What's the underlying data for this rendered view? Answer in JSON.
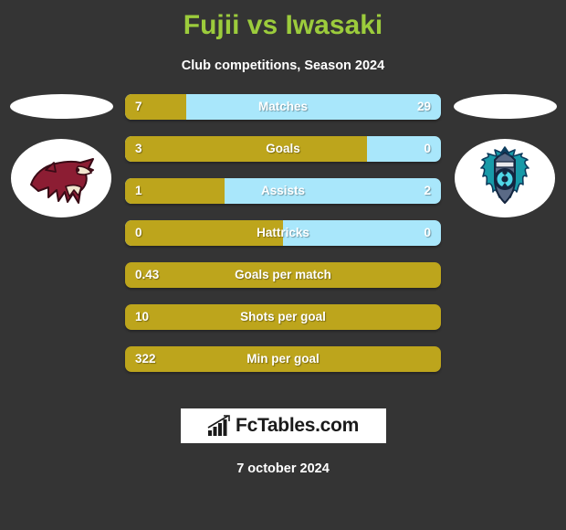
{
  "header": {
    "title": "Fujii vs Iwasaki",
    "subtitle": "Club competitions, Season 2024",
    "title_color": "#9ccc3c"
  },
  "teams": {
    "left": {
      "crest": "coyote-head-crest",
      "name": ""
    },
    "right": {
      "crest": "ornate-shield-crest",
      "name": ""
    }
  },
  "colors": {
    "background": "#343434",
    "home_bar": "#bda51c",
    "away_bar": "#a9e7fb",
    "text": "#ffffff"
  },
  "stats": [
    {
      "label": "Matches",
      "left": "7",
      "right": "29",
      "left_pct": 19.4,
      "split": true
    },
    {
      "label": "Goals",
      "left": "3",
      "right": "0",
      "left_pct": 76.6,
      "split": true
    },
    {
      "label": "Assists",
      "left": "1",
      "right": "2",
      "left_pct": 31.5,
      "split": true
    },
    {
      "label": "Hattricks",
      "left": "0",
      "right": "0",
      "left_pct": 50.0,
      "split": true
    },
    {
      "label": "Goals per match",
      "left": "0.43",
      "right": "",
      "left_pct": 100,
      "split": false
    },
    {
      "label": "Shots per goal",
      "left": "10",
      "right": "",
      "left_pct": 100,
      "split": false
    },
    {
      "label": "Min per goal",
      "left": "322",
      "right": "",
      "left_pct": 100,
      "split": false
    }
  ],
  "footer": {
    "brand": "FcTables.com",
    "date": "7 october 2024"
  }
}
